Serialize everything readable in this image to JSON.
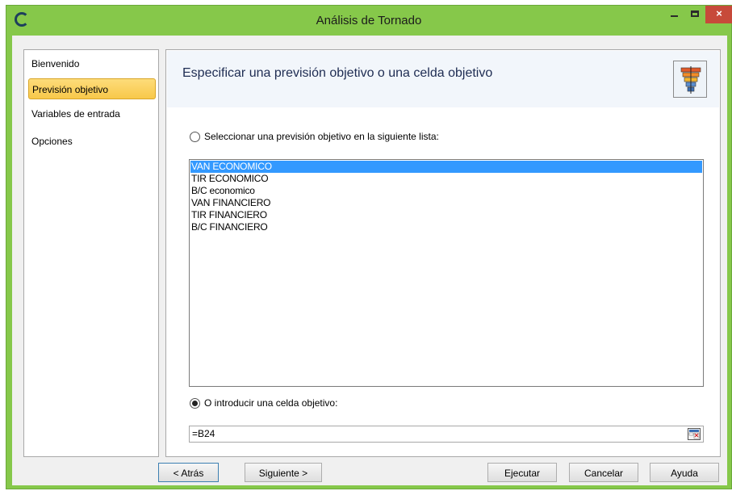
{
  "window": {
    "title": "Análisis de Tornado",
    "controls": {
      "minimize": "–",
      "maximize": "□",
      "close": "×"
    }
  },
  "sidebar": {
    "items": [
      {
        "label": "Bienvenido",
        "selected": false
      },
      {
        "label": "Previsión objetivo",
        "selected": true
      },
      {
        "label": "Variables de entrada",
        "selected": false
      },
      {
        "label": "Opciones",
        "selected": false
      }
    ]
  },
  "main": {
    "heading": "Especificar una previsión objetivo o una celda objetivo",
    "header_icon": "tornado-chart-icon",
    "option_list_label": "Seleccionar una previsión objetivo en la siguiente lista:",
    "option_list_checked": false,
    "forecasts": [
      {
        "label": "VAN ECONOMICO",
        "selected": true
      },
      {
        "label": "TIR ECONOMICO",
        "selected": false
      },
      {
        "label": "B/C economico",
        "selected": false
      },
      {
        "label": "VAN FINANCIERO",
        "selected": false
      },
      {
        "label": "TIR FINANCIERO",
        "selected": false
      },
      {
        "label": "B/C FINANCIERO",
        "selected": false
      }
    ],
    "option_cell_label": "O introducir una celda objetivo:",
    "option_cell_checked": true,
    "cell_value": "=B24"
  },
  "buttons": {
    "back": "< Atrás",
    "next": "Siguiente >",
    "run": "Ejecutar",
    "cancel": "Cancelar",
    "help": "Ayuda"
  },
  "colors": {
    "frame": "#86c84a",
    "selection": "#3399ff",
    "nav_selected": "#f8c84a",
    "close_button": "#c74a3a"
  }
}
